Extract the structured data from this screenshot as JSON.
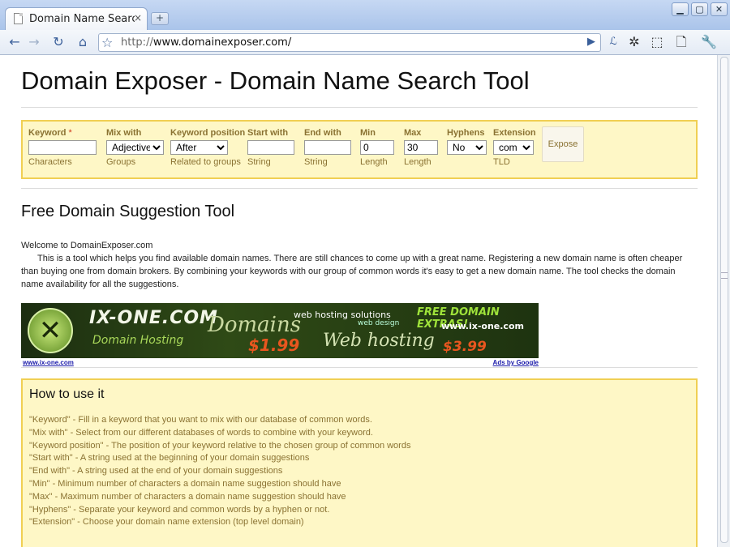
{
  "browser": {
    "tab_title": "Domain Name Searc...",
    "tab_close": "×",
    "new_tab": "+",
    "window_buttons": [
      "▁",
      "▢",
      "✕"
    ],
    "url_prefix": "http://",
    "url_host": "www.domainexposer.com/",
    "icons": [
      "back-icon",
      "forward-icon",
      "reload-icon",
      "home-icon",
      "bookmark-star-icon",
      "go-icon",
      "extension-icon",
      "puzzle-icon",
      "window-icon",
      "page-menu-icon",
      "wrench-icon"
    ]
  },
  "page": {
    "title": "Domain Exposer - Domain Name Search Tool",
    "search": {
      "keyword": {
        "label": "Keyword",
        "required": "*",
        "value": "",
        "sub": "Characters"
      },
      "mix_with": {
        "label": "Mix with",
        "value": "Adjectives",
        "sub": "Groups"
      },
      "keyword_position": {
        "label": "Keyword position",
        "value": "After",
        "sub": "Related to groups"
      },
      "start_with": {
        "label": "Start with",
        "value": "",
        "sub": "String"
      },
      "end_with": {
        "label": "End with",
        "value": "",
        "sub": "String"
      },
      "min": {
        "label": "Min",
        "value": "0",
        "sub": "Length"
      },
      "max": {
        "label": "Max",
        "value": "30",
        "sub": "Length"
      },
      "hyphens": {
        "label": "Hyphens",
        "value": "No",
        "sub": ""
      },
      "extension": {
        "label": "Extension",
        "value": "com",
        "sub": "TLD"
      },
      "submit_label": "Expose"
    },
    "section_title": "Free Domain Suggestion Tool",
    "welcome_line": "Welcome to DomainExposer.com",
    "intro": "This is a tool which helps you find available domain names. There are still chances to come up with a great name. Registering a new domain name is often cheaper than buying one from domain brokers. By combining your keywords with our group of common words it's easy to get a new domain name. The tool checks the domain name availability for all the suggestions.",
    "ad": {
      "brand": "IX-ONE.COM",
      "brand_sub": "Domain Hosting",
      "domains": "Domains",
      "price1": "$1.99",
      "services": "web hosting solutions",
      "services2": "web design",
      "web_hosting": "Web hosting",
      "price2": "$3.99",
      "extras": "FREE DOMAIN EXTRAS!",
      "url": "www.ix-one.com",
      "link_left": "www.ix-one.com",
      "link_right": "Ads by Google"
    },
    "howto": {
      "title": "How to use it",
      "items": [
        "\"Keyword\" - Fill in a keyword that you want to mix with our database of common words.",
        "\"Mix with\" - Select from our different databases of words to combine with your keyword.",
        "\"Keyword position\" - The position of your keyword relative to the chosen group of common words",
        "\"Start with\" - A string used at the beginning of your domain suggestions",
        "\"End with\" - A string used at the end of your domain suggestions",
        "\"Min\" - Minimum number of characters a domain name suggestion should have",
        "\"Max\" - Maximum number of characters a domain name suggestion should have",
        "\"Hyphens\" - Separate your keyword and common words by a hyphen or not.",
        "\"Extension\" - Choose your domain name extension (top level domain)"
      ]
    }
  }
}
